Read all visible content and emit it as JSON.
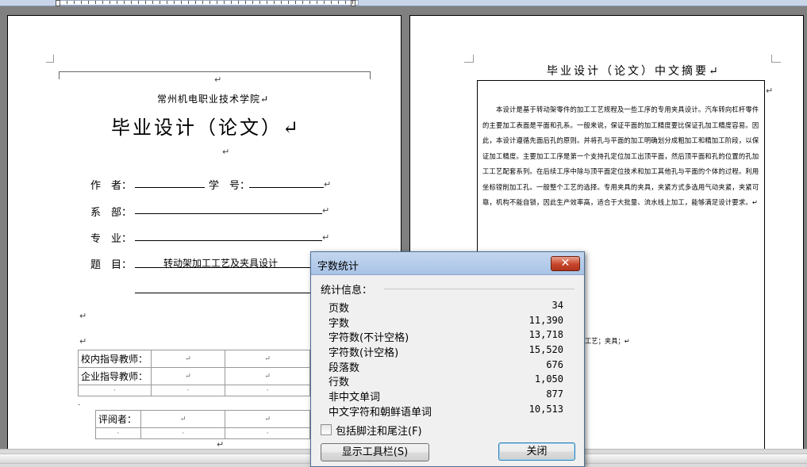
{
  "left_page": {
    "school": "常州机电职业技术学院↵",
    "title": "毕业设计（论文）↵",
    "fields": {
      "author_label": "作　者：",
      "student_id_label": "学　号：",
      "department_label": "系　部：",
      "major_label": "专　业：",
      "topic_label": "题　目：",
      "topic_value": "转动架加工工艺及夹具设计"
    },
    "advisor_table": {
      "row1_label": "校内指导教师：",
      "row2_label": "企业指导教师：",
      "reviewer_label": "评阅者：",
      "para_mark": "↵",
      "cell_mark": "↵",
      "small_mark": "·"
    }
  },
  "right_page": {
    "abstract_title": "毕业设计（论文）中文摘要↵",
    "abstract_text": "　　本设计是基于转动架零件的加工工艺规程及一些工序的专用夹具设计。汽车转向杠杆零件的主要加工表面是平面和孔系。一般来说，保证平面的加工精度要比保证孔加工精度容易。因此，本设计遵循先面后孔的原则。并将孔与平面的加工明确划分成粗加工和精加工阶段，以保证加工精度。主要加工工序是第一个支持孔定位加工出顶平面，然后顶平面和孔的位置的孔加工工艺配套系列。在后续工序中除与顶平面定位技术和加工其他孔与平面的个体的过程。利用坐标镗削加工孔。一般整个工艺的选择。专用夹具的夹具，夹紧方式多选用气动夹紧，夹紧可靠，机构不能自锁，因此生产效率高，适合于大批量、流水线上加工，能够满足设计要求。↵",
    "keywords_fragment": "工艺；夹具；↵"
  },
  "dialog": {
    "title": "字数统计",
    "close_icon": "close-x",
    "stats_header": "统计信息：",
    "stats": [
      {
        "label": "页数",
        "value": "34"
      },
      {
        "label": "字数",
        "value": "11,390"
      },
      {
        "label": "字符数(不计空格)",
        "value": "13,718"
      },
      {
        "label": "字符数(计空格)",
        "value": "15,520"
      },
      {
        "label": "段落数",
        "value": "676"
      },
      {
        "label": "行数",
        "value": "1,050"
      },
      {
        "label": "非中文单词",
        "value": "877"
      },
      {
        "label": "中文字符和朝鲜语单词",
        "value": "10,513"
      }
    ],
    "include_footnotes_label": "包括脚注和尾注(F)",
    "include_footnotes_checked": false,
    "show_toolbar_label": "显示工具栏(S)",
    "close_label": "关闭"
  },
  "colors": {
    "workspace": "#808080",
    "titlebar": "#b5cbe8",
    "close_red": "#c6452a"
  }
}
